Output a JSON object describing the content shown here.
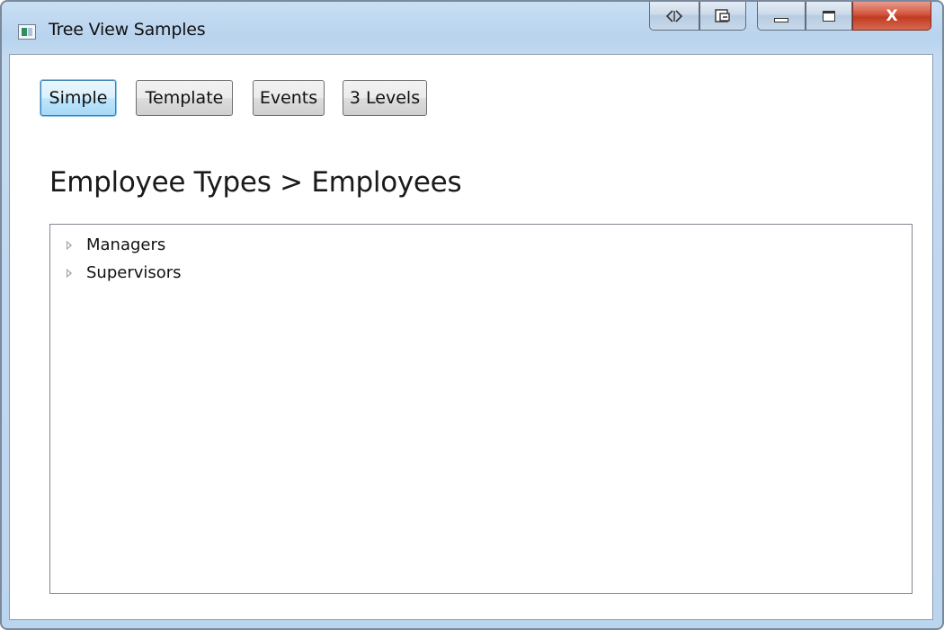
{
  "window": {
    "title": "Tree View Samples",
    "icon": "app-window-icon",
    "caption_buttons": {
      "extra1_icon": "code-brackets-icon",
      "extra2_icon": "select-element-icon",
      "minimize_icon": "minimize-icon",
      "maximize_icon": "maximize-icon",
      "close_label": "X"
    }
  },
  "toolbar": {
    "buttons": [
      {
        "label": "Simple",
        "selected": true
      },
      {
        "label": "Template",
        "selected": false
      },
      {
        "label": "Events",
        "selected": false
      },
      {
        "label": "3 Levels",
        "selected": false
      }
    ]
  },
  "main": {
    "heading": "Employee Types > Employees",
    "tree": {
      "items": [
        {
          "label": "Managers",
          "expanded": false
        },
        {
          "label": "Supervisors",
          "expanded": false
        }
      ]
    }
  },
  "colors": {
    "selected_button_border": "#3c7fb1",
    "close_button": "#c13b22",
    "frame": "#b8d3ee"
  }
}
